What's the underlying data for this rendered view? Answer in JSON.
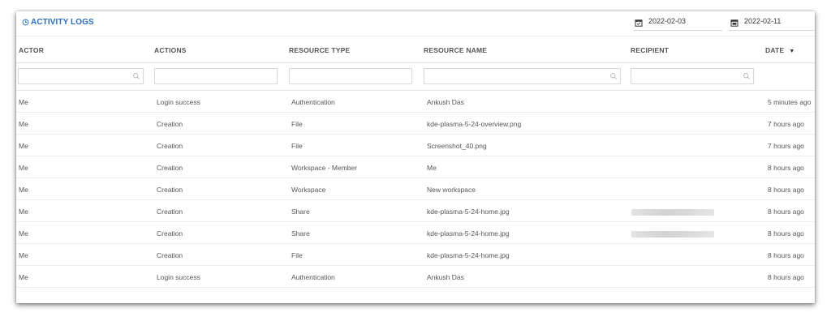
{
  "page": {
    "title": "ACTIVITY LOGS",
    "date_from": "2022-02-03",
    "date_to": "2022-02-11"
  },
  "columns": [
    "ACTOR",
    "ACTIONS",
    "RESOURCE TYPE",
    "RESOURCE NAME",
    "RECIPIENT",
    "DATE"
  ],
  "sort_indicator": "▼",
  "rows": [
    {
      "actor": "Me",
      "action": "Login success",
      "type": "Authentication",
      "name": "Ankush Das",
      "recipient": "",
      "date": "5 minutes ago",
      "recipient_redacted": false
    },
    {
      "actor": "Me",
      "action": "Creation",
      "type": "File",
      "name": "kde-plasma-5-24-overview.png",
      "recipient": "",
      "date": "7 hours ago",
      "recipient_redacted": false
    },
    {
      "actor": "Me",
      "action": "Creation",
      "type": "File",
      "name": "Screenshot_40.png",
      "recipient": "",
      "date": "7 hours ago",
      "recipient_redacted": false
    },
    {
      "actor": "Me",
      "action": "Creation",
      "type": "Workspace - Member",
      "name": "Me",
      "recipient": "",
      "date": "8 hours ago",
      "recipient_redacted": false
    },
    {
      "actor": "Me",
      "action": "Creation",
      "type": "Workspace",
      "name": "New workspace",
      "recipient": "",
      "date": "8 hours ago",
      "recipient_redacted": false
    },
    {
      "actor": "Me",
      "action": "Creation",
      "type": "Share",
      "name": "kde-plasma-5-24-home.jpg",
      "recipient": "",
      "date": "8 hours ago",
      "recipient_redacted": true
    },
    {
      "actor": "Me",
      "action": "Creation",
      "type": "Share",
      "name": "kde-plasma-5-24-home.jpg",
      "recipient": "",
      "date": "8 hours ago",
      "recipient_redacted": true
    },
    {
      "actor": "Me",
      "action": "Creation",
      "type": "File",
      "name": "kde-plasma-5-24-home.jpg",
      "recipient": "",
      "date": "8 hours ago",
      "recipient_redacted": false
    },
    {
      "actor": "Me",
      "action": "Login success",
      "type": "Authentication",
      "name": "Ankush Das",
      "recipient": "",
      "date": "8 hours ago",
      "recipient_redacted": false
    }
  ],
  "colors": {
    "accent": "#2a6ebb",
    "text": "#555555",
    "border": "#e4e4e4"
  },
  "icons": {
    "title": "clock-history-icon",
    "date": "calendar-icon",
    "filter": "magnifier-icon"
  }
}
